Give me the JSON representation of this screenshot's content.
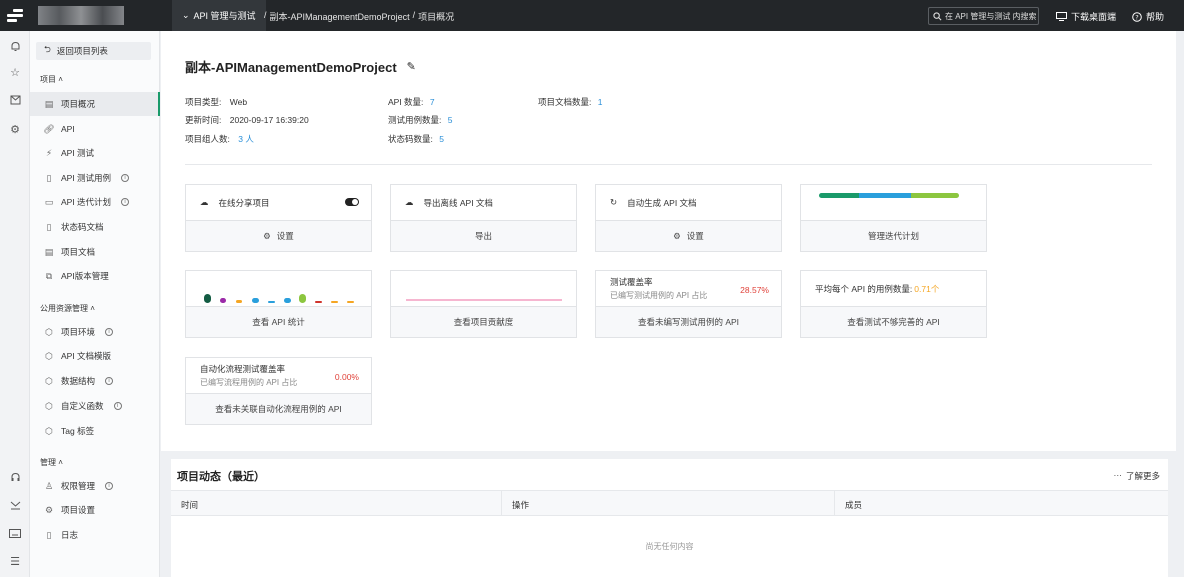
{
  "topbar": {
    "menu_label": "API 管理与测试",
    "breadcrumb": [
      "副本-APIManagementDemoProject",
      "/",
      "项目概况"
    ],
    "search_placeholder": "在 API 管理与测试 内搜索",
    "download_label": "下载桌面端",
    "help_label": "帮助"
  },
  "sidebar": {
    "back_label": "返回项目列表",
    "section_project": "项目",
    "section_public": "公用资源管理",
    "section_manage": "管理",
    "project_items": [
      {
        "label": "项目概况",
        "icon": "dashboard-icon",
        "active": true
      },
      {
        "label": "API",
        "icon": "link-icon"
      },
      {
        "label": "API 测试",
        "icon": "test-icon"
      },
      {
        "label": "API 测试用例",
        "icon": "case-icon",
        "info": true
      },
      {
        "label": "API 迭代计划",
        "icon": "plan-icon",
        "info": true
      },
      {
        "label": "状态码文档",
        "icon": "doc-icon"
      },
      {
        "label": "项目文档",
        "icon": "file-icon"
      },
      {
        "label": "API版本管理",
        "icon": "version-icon"
      }
    ],
    "public_items": [
      {
        "label": "项目环境",
        "icon": "cube-icon",
        "info": true
      },
      {
        "label": "API 文档模版",
        "icon": "cube-icon"
      },
      {
        "label": "数据结构",
        "icon": "cube-icon",
        "info": true
      },
      {
        "label": "自定义函数",
        "icon": "cube-icon",
        "info": true
      },
      {
        "label": "Tag 标签",
        "icon": "cube-icon"
      }
    ],
    "manage_items": [
      {
        "label": "权限管理",
        "icon": "user-icon",
        "info": true
      },
      {
        "label": "项目设置",
        "icon": "gear-icon"
      },
      {
        "label": "日志",
        "icon": "log-icon"
      }
    ]
  },
  "project": {
    "title": "副本-APIManagementDemoProject",
    "type_label": "项目类型:",
    "type_value": "Web",
    "updated_label": "更新时间:",
    "updated_value": "2020-09-17 16:39:20",
    "members_label": "项目组人数:",
    "members_value": "3 人",
    "api_count_label": "API 数量:",
    "api_count_value": "7",
    "case_count_label": "测试用例数量:",
    "case_count_value": "5",
    "status_count_label": "状态码数量:",
    "status_count_value": "5",
    "doc_count_label": "项目文档数量:",
    "doc_count_value": "1"
  },
  "cards": {
    "share_label": "在线分享项目",
    "share_action": "设置",
    "export_label": "导出离线 API 文档",
    "export_action": "导出",
    "autogen_label": "自动生成 API 文档",
    "autogen_action": "设置",
    "iteration_action": "管理迭代计划",
    "api_stats_action": "查看 API 统计",
    "contrib_action": "查看项目贡献度",
    "coverage_title": "测试覆盖率",
    "coverage_desc": "已编写测试用例的 API 占比",
    "coverage_pct": "28.57%",
    "coverage_action": "查看未编写测试用例的 API",
    "avg_title": "平均每个 API 的用例数量:",
    "avg_value": "0.71个",
    "avg_action": "查看测试不够完善的 API",
    "auto_title": "自动化流程测试覆盖率",
    "auto_desc": "已编写流程用例的 API 占比",
    "auto_pct": "0.00%",
    "auto_action": "查看未关联自动化流程用例的 API"
  },
  "colors": {
    "accent_green": "#1a9a6a",
    "link_blue": "#2a8fd8",
    "percent_red": "#e0423a",
    "avg_orange": "#f5a623",
    "bar_segments": [
      "#1a9a6a",
      "#2a9fdc",
      "#8cc63f"
    ],
    "dots": [
      "#135c43",
      "#9b2aa8",
      "#f5a623",
      "#2a9fdc",
      "#2a9fdc",
      "#2a9fdc",
      "#8cc63f",
      "#d0342c",
      "#f5a623",
      "#f5a623"
    ],
    "line_pink": "#f08ab4"
  },
  "activity": {
    "title": "项目动态（最近）",
    "more_label": "了解更多",
    "columns": [
      "时间",
      "操作",
      "成员"
    ],
    "empty_text": "尚无任何内容"
  }
}
